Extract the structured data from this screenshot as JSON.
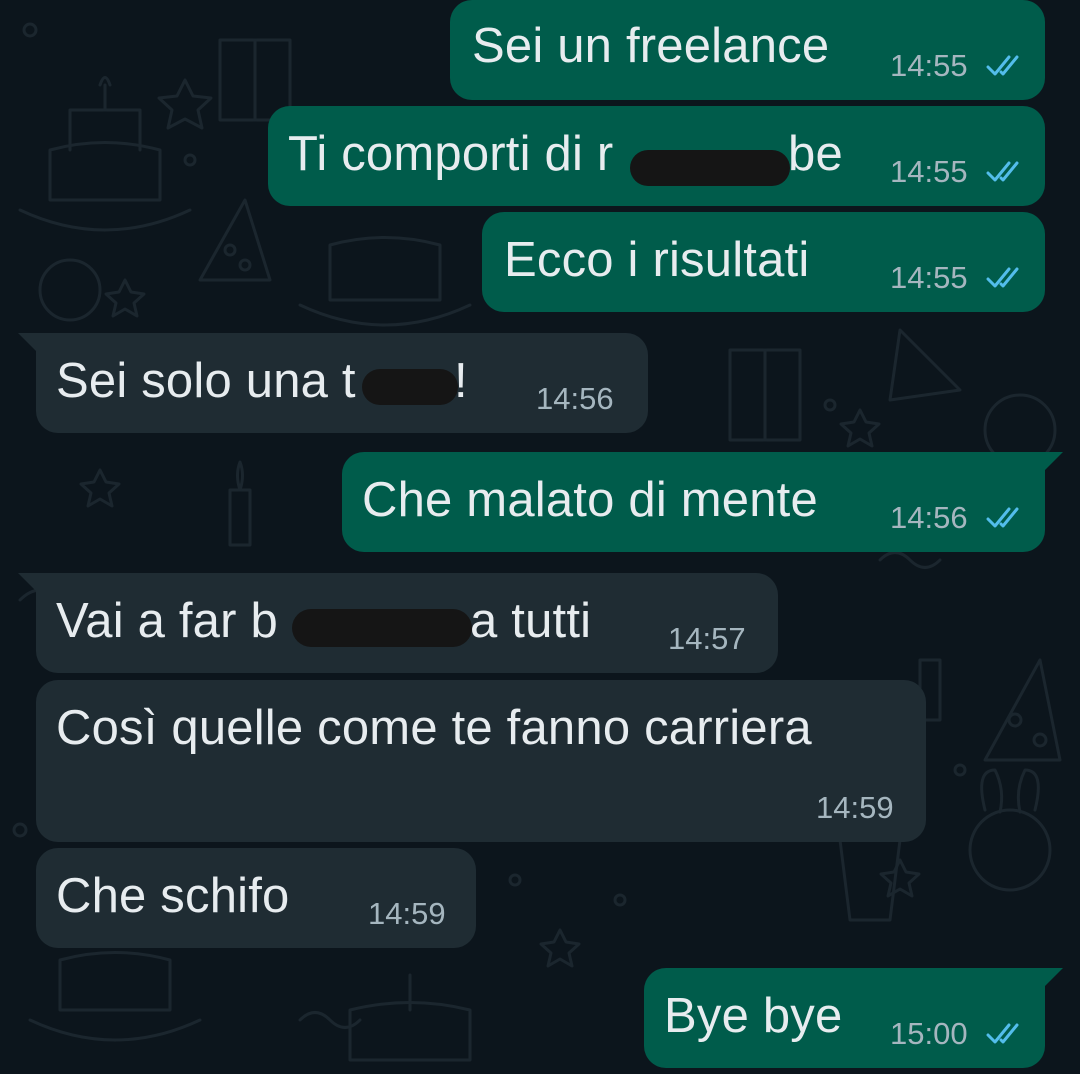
{
  "theme": {
    "background": "#0c151c",
    "outgoing_bubble": "#005c4b",
    "incoming_bubble": "#1f2c33",
    "text": "#e7ecef",
    "timestamp": "#a5b6bf",
    "read_ticks": "#53bdeb"
  },
  "messages": [
    {
      "direction": "outgoing",
      "text": "Sei un freelance",
      "time": "14:55",
      "status": "read"
    },
    {
      "direction": "outgoing",
      "text": "Ti comporti di r",
      "text_tail": "be",
      "redacted": true,
      "time": "14:55",
      "status": "read"
    },
    {
      "direction": "outgoing",
      "text": "Ecco i risultati",
      "time": "14:55",
      "status": "read"
    },
    {
      "direction": "incoming",
      "text": "Sei solo una t",
      "text_tail": "!",
      "redacted": true,
      "time": "14:56"
    },
    {
      "direction": "outgoing",
      "text": "Che malato di mente",
      "time": "14:56",
      "status": "read"
    },
    {
      "direction": "incoming",
      "text": "Vai a far b",
      "text_tail": "a tutti",
      "redacted": true,
      "time": "14:57"
    },
    {
      "direction": "incoming",
      "text": "Così quelle come te fanno carriera",
      "time": "14:59"
    },
    {
      "direction": "incoming",
      "text": "Che schifo",
      "time": "14:59"
    },
    {
      "direction": "outgoing",
      "text": "Bye bye",
      "time": "15:00",
      "status": "read"
    }
  ],
  "icons": {
    "read_receipt": "double-check-icon",
    "wallpaper": "doodle-pattern"
  }
}
